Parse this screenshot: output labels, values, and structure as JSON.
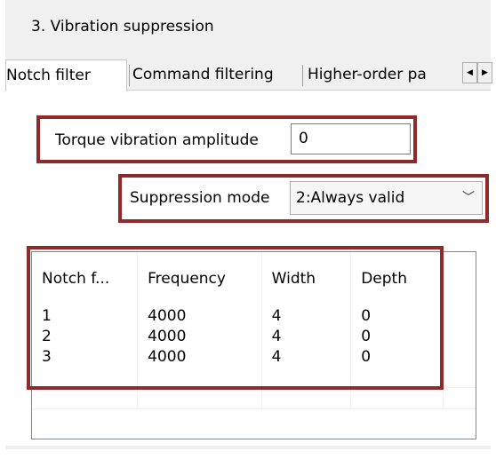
{
  "section": {
    "title": "3. Vibration suppression"
  },
  "tabs": [
    {
      "label": "Notch filter",
      "active": true
    },
    {
      "label": "Command filtering",
      "active": false
    },
    {
      "label": "Higher-order pa",
      "active": false
    }
  ],
  "tab_scroll": {
    "left_glyph": "◀",
    "right_glyph": "▶"
  },
  "torque": {
    "label": "Torque vibration amplitude",
    "value": "0"
  },
  "suppression": {
    "label": "Suppression mode",
    "selected": "2:Always valid",
    "chevron": "﹀"
  },
  "table": {
    "columns": [
      "Notch f...",
      "Frequency",
      "Width",
      "Depth"
    ],
    "rows": [
      [
        "1",
        "4000",
        "4",
        "0"
      ],
      [
        "2",
        "4000",
        "4",
        "0"
      ],
      [
        "3",
        "4000",
        "4",
        "0"
      ]
    ]
  },
  "highlight_color": "#8e2a2a"
}
